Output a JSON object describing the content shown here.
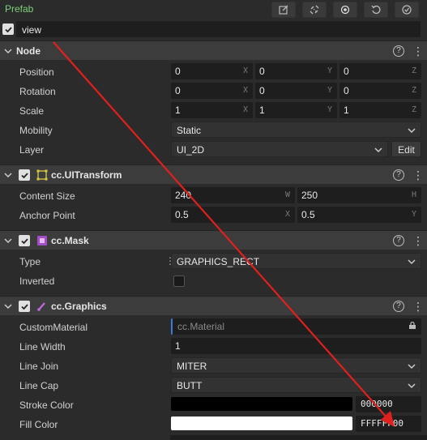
{
  "topbar": {
    "prefab_label": "Prefab",
    "tools": [
      {
        "icon": "edit-icon"
      },
      {
        "icon": "unlink-icon"
      },
      {
        "icon": "locate-icon"
      },
      {
        "icon": "revert-icon"
      },
      {
        "icon": "apply-icon"
      }
    ]
  },
  "node_name": {
    "checked": true,
    "value": "view"
  },
  "sections": {
    "node": {
      "title": "Node",
      "position": {
        "label": "Position",
        "x": "0",
        "y": "0",
        "z": "0",
        "axes": [
          "X",
          "Y",
          "Z"
        ]
      },
      "rotation": {
        "label": "Rotation",
        "x": "0",
        "y": "0",
        "z": "0",
        "axes": [
          "X",
          "Y",
          "Z"
        ]
      },
      "scale": {
        "label": "Scale",
        "x": "1",
        "y": "1",
        "z": "1",
        "axes": [
          "X",
          "Y",
          "Z"
        ]
      },
      "mobility": {
        "label": "Mobility",
        "value": "Static"
      },
      "layer": {
        "label": "Layer",
        "value": "UI_2D",
        "edit_label": "Edit"
      }
    },
    "uitransform": {
      "title": "cc.UITransform",
      "content_size": {
        "label": "Content Size",
        "w": "240",
        "h": "250",
        "axes": [
          "W",
          "H"
        ]
      },
      "anchor_point": {
        "label": "Anchor Point",
        "x": "0.5",
        "y": "0.5",
        "axes": [
          "X",
          "Y"
        ]
      }
    },
    "mask": {
      "title": "cc.Mask",
      "type": {
        "label": "Type",
        "value": "GRAPHICS_RECT"
      },
      "inverted": {
        "label": "Inverted",
        "checked": false
      }
    },
    "graphics": {
      "title": "cc.Graphics",
      "custom_material": {
        "label": "CustomMaterial",
        "placeholder": "cc.Material"
      },
      "line_width": {
        "label": "Line Width",
        "value": "1"
      },
      "line_join": {
        "label": "Line Join",
        "value": "MITER"
      },
      "line_cap": {
        "label": "Line Cap",
        "value": "BUTT"
      },
      "stroke_color": {
        "label": "Stroke Color",
        "hex": "000000",
        "color": "#000000"
      },
      "fill_color": {
        "label": "Fill Color",
        "hex": "FFFFFF00",
        "color": "#ffffff"
      }
    }
  },
  "colors": {
    "accent_green": "#7ad17a",
    "annotation_arrow": "#e0201c",
    "asset_border": "#3a7bd5"
  }
}
